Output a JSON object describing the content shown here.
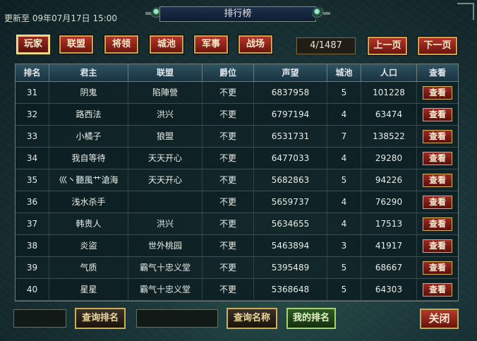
{
  "update_label": "更新至 09年07月17日 15:00",
  "window_title": "排行榜",
  "tabs": [
    {
      "label": "玩家",
      "active": true
    },
    {
      "label": "联盟",
      "active": false
    },
    {
      "label": "将领",
      "active": false
    },
    {
      "label": "城池",
      "active": false
    },
    {
      "label": "军事",
      "active": false
    },
    {
      "label": "战场",
      "active": false
    }
  ],
  "pagination": {
    "page_display": "4/1487",
    "prev_label": "上一页",
    "next_label": "下一页"
  },
  "table": {
    "headers": [
      "排名",
      "君主",
      "联盟",
      "爵位",
      "声望",
      "城池",
      "人口",
      "查看"
    ],
    "view_label": "查看",
    "rows": [
      {
        "rank": "31",
        "lord": "阴鬼",
        "alliance": "陷陣營",
        "title": "不更",
        "prestige": "6837958",
        "cities": "5",
        "population": "101228"
      },
      {
        "rank": "32",
        "lord": "路西法",
        "alliance": "洪兴",
        "title": "不更",
        "prestige": "6797194",
        "cities": "4",
        "population": "63474"
      },
      {
        "rank": "33",
        "lord": "小橘子",
        "alliance": "狼盟",
        "title": "不更",
        "prestige": "6531731",
        "cities": "7",
        "population": "138522"
      },
      {
        "rank": "34",
        "lord": "我自等待",
        "alliance": "天天开心",
        "title": "不更",
        "prestige": "6477033",
        "cities": "4",
        "population": "29280"
      },
      {
        "rank": "35",
        "lord": "巛丶聽風艹滄海",
        "alliance": "天天开心",
        "title": "不更",
        "prestige": "5682863",
        "cities": "5",
        "population": "94226"
      },
      {
        "rank": "36",
        "lord": "浅水杀手",
        "alliance": "",
        "title": "不更",
        "prestige": "5659737",
        "cities": "4",
        "population": "76290"
      },
      {
        "rank": "37",
        "lord": "韩贵人",
        "alliance": "洪兴",
        "title": "不更",
        "prestige": "5634655",
        "cities": "4",
        "population": "17513"
      },
      {
        "rank": "38",
        "lord": "炎盜",
        "alliance": "世外桃园",
        "title": "不更",
        "prestige": "5463894",
        "cities": "3",
        "population": "41917"
      },
      {
        "rank": "39",
        "lord": "气质",
        "alliance": "霸气十忠义堂",
        "title": "不更",
        "prestige": "5395489",
        "cities": "5",
        "population": "68667"
      },
      {
        "rank": "40",
        "lord": "星星",
        "alliance": "霸气十忠义堂",
        "title": "不更",
        "prestige": "5368648",
        "cities": "5",
        "population": "64303"
      }
    ]
  },
  "bottom": {
    "rank_input_value": "",
    "query_rank_label": "查询排名",
    "name_input_value": "",
    "query_name_label": "查询名称",
    "my_rank_label": "我的排名",
    "close_label": "关闭"
  }
}
